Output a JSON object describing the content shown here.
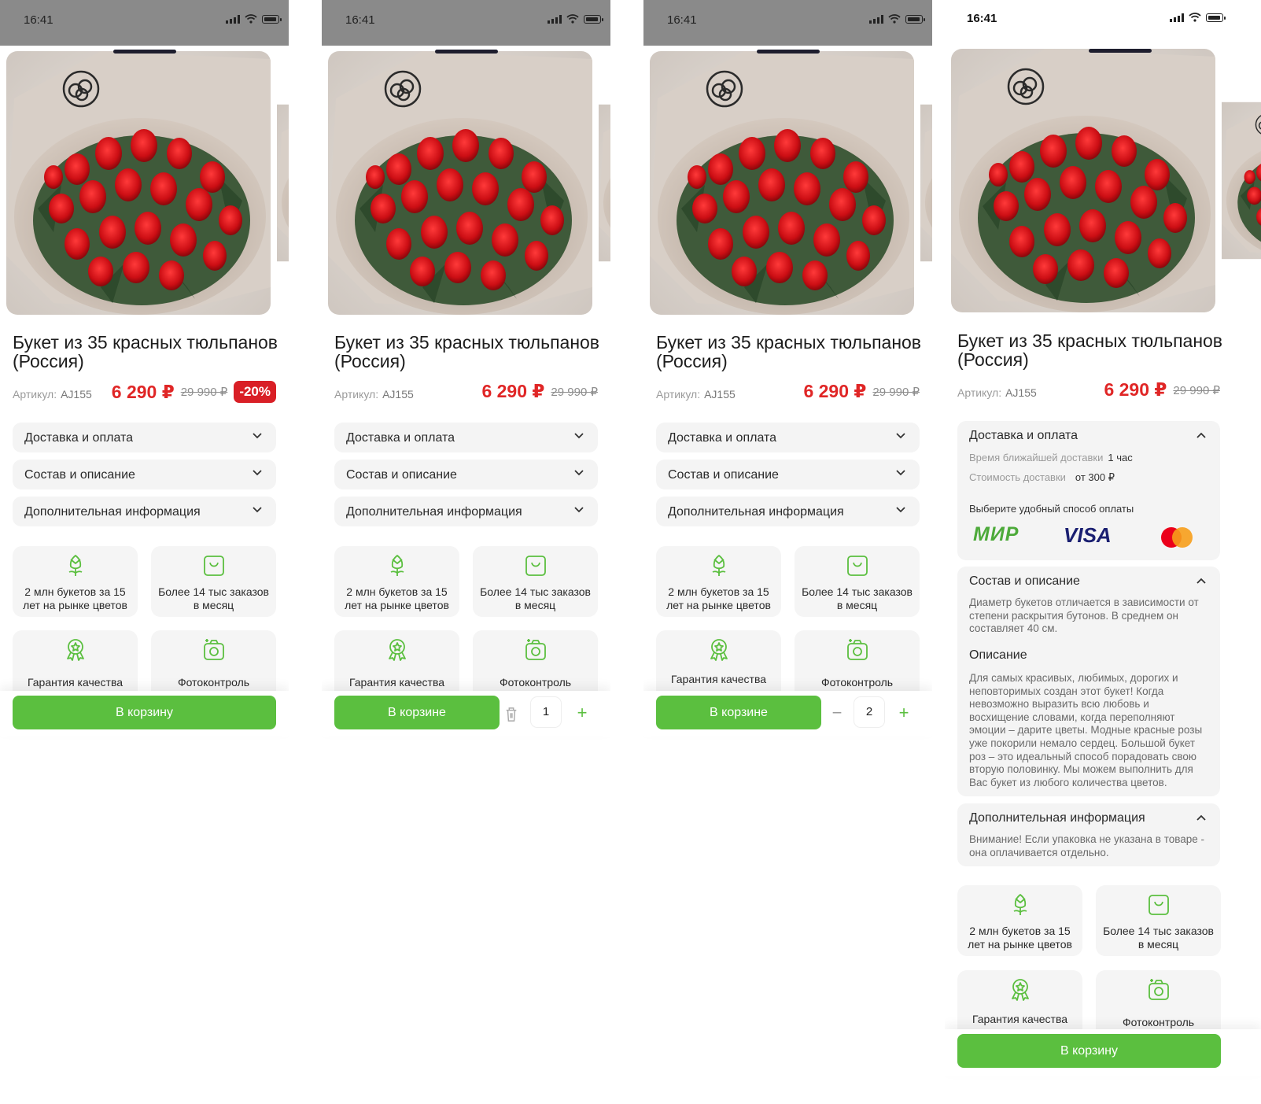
{
  "status": {
    "time": "16:41"
  },
  "product": {
    "title": "Букет из 35 красных тюльпанов (Россия)",
    "sku_label": "Артикул:",
    "sku": "AJ155",
    "price": "6 290 ₽",
    "old_price": "29 990 ₽",
    "discount": "-20%"
  },
  "accordion": {
    "delivery": "Доставка и оплата",
    "composition": "Состав и описание",
    "extra": "Дополнительная информация"
  },
  "features": {
    "years": "2 млн букетов за 15 лет на рынке цветов",
    "orders": "Более 14 тыс заказов в месяц",
    "quality": "Гарантия качества",
    "photo": "Фотоконтроль"
  },
  "cart": {
    "add": "В корзину",
    "in_cart": "В корзине",
    "qty_screen2": "1",
    "qty_screen3": "2"
  },
  "details": {
    "delivery_time_label": "Время ближайшей доставки",
    "delivery_time_value": "1 час",
    "delivery_cost_label": "Стоимость доставки",
    "delivery_cost_value": "от 300 ₽",
    "payment_prompt": "Выберите удобный способ оплаты",
    "pay_mir": "МИР",
    "pay_visa": "VISA",
    "composition_text": "Диаметр букетов отличается в зависимости от степени раскрытия бутонов. В среднем он составляет 40 см.",
    "description_title": "Описание",
    "description_text": "Для самых красивых, любимых, дорогих и неповторимых создан этот букет! Когда невозможно выразить всю любовь и восхищение словами, когда переполняют эмоции – дарите цветы. Модные красные розы уже покорили немало сердец. Большой букет роз – это идеальный способ порадовать свою вторую половинку. Мы можем выполнить для Вас букет из любого количества цветов.",
    "extra_text": "Внимание! Если упаковка не указана в товаре - она оплачивается отдельно."
  },
  "colors": {
    "accent_green": "#5bbf3f",
    "price_red": "#e02626",
    "badge_red": "#d91f26"
  }
}
